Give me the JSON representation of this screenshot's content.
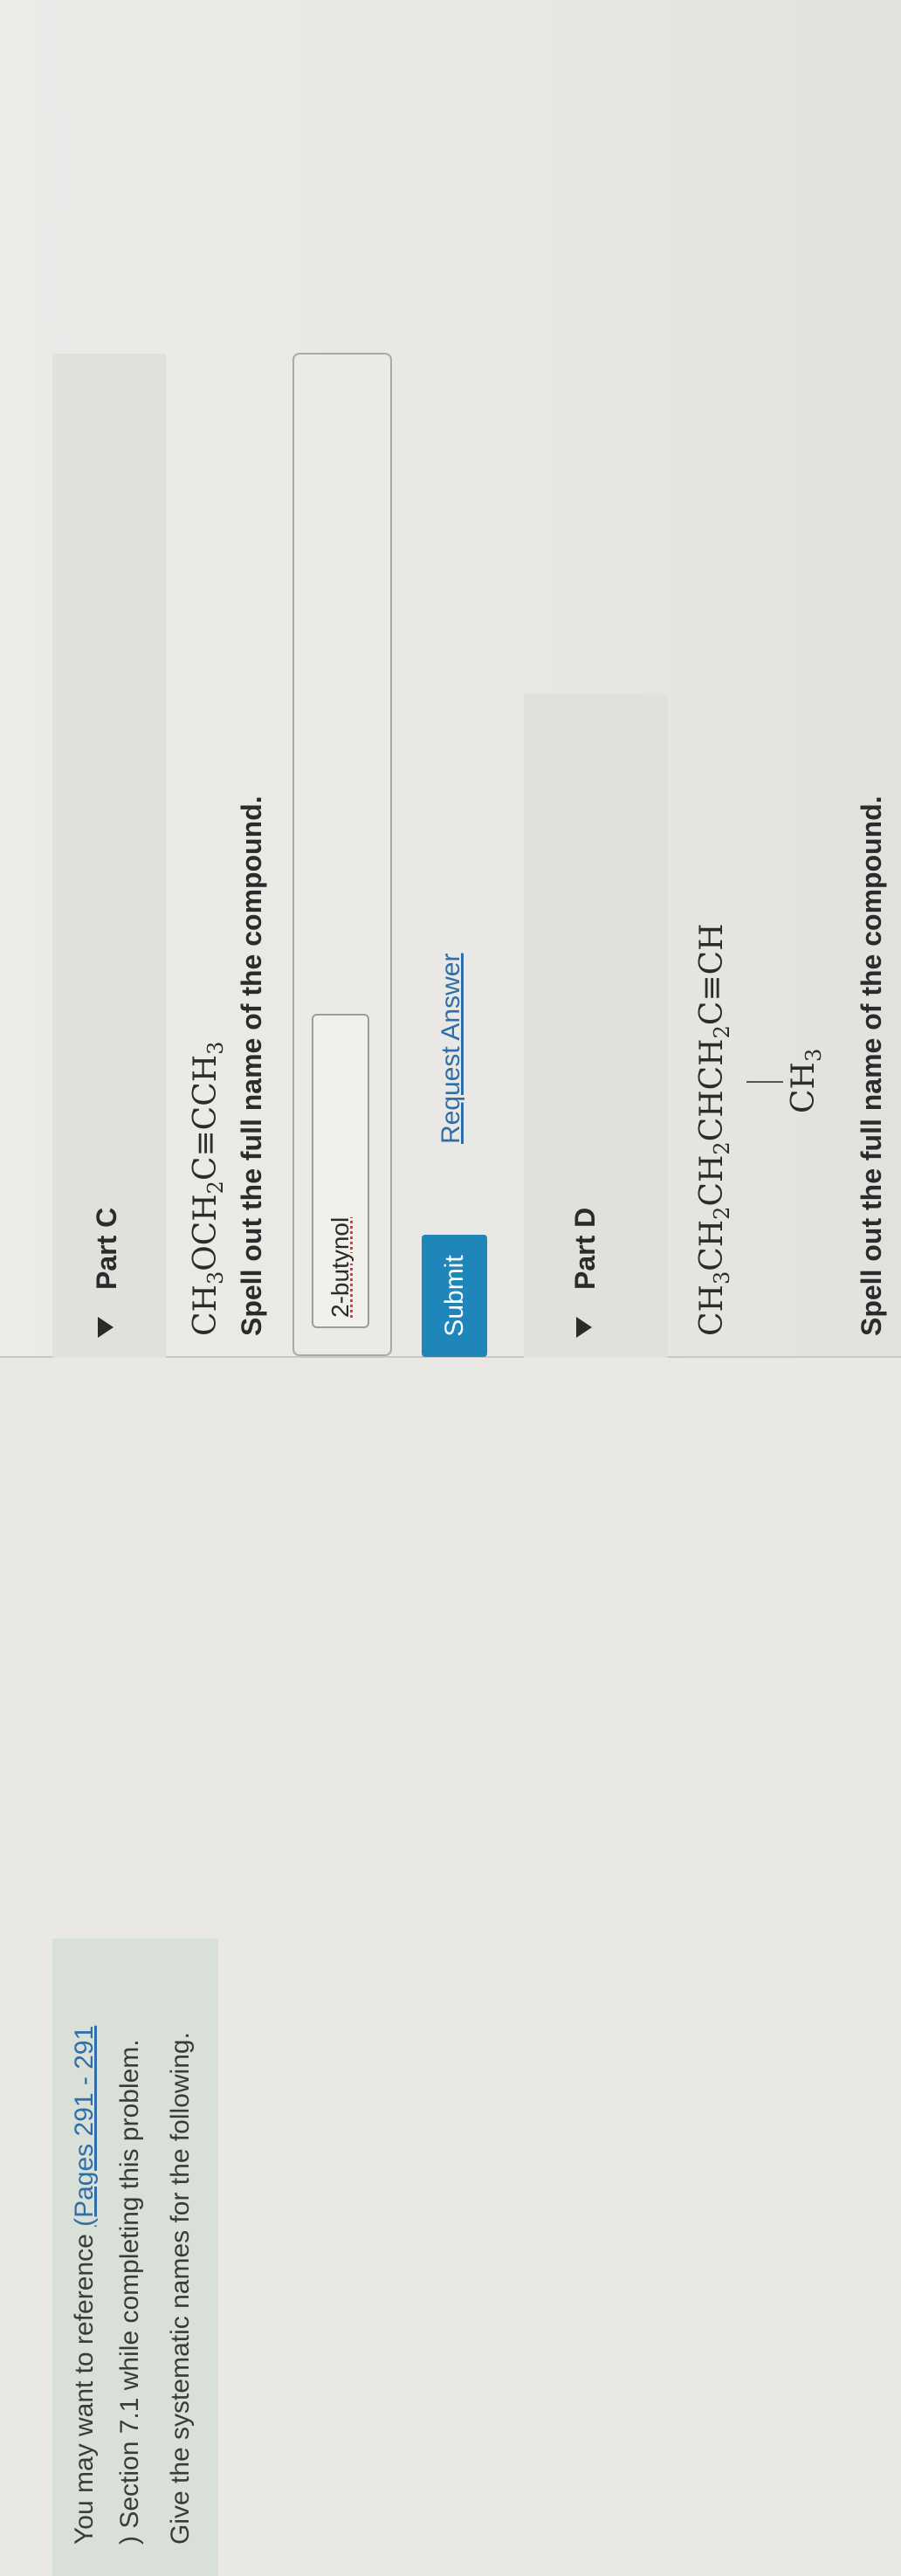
{
  "intro": {
    "ref_prefix": "You may want to reference",
    "ref_link": "(Pages 291 - 291",
    "ref_suffix": ") Section 7.1 while completing this problem.",
    "instruction": "Give the systematic names for the following."
  },
  "part_c": {
    "label": "Part C",
    "formula": [
      "CH",
      "3",
      "OCH",
      "2",
      "C≡CCH",
      "3"
    ],
    "prompt": "Spell out the full name of the compound.",
    "answer_value": "2-butynol",
    "submit_label": "Submit",
    "request_label": "Request Answer"
  },
  "part_d": {
    "label": "Part D",
    "formula": [
      "CH",
      "3",
      "CH",
      "2",
      "CH",
      "2",
      "CHCH",
      "2",
      "C≡CH"
    ],
    "substituent": [
      "CH",
      "3"
    ],
    "prompt": "Spell out the full name of the compound."
  }
}
